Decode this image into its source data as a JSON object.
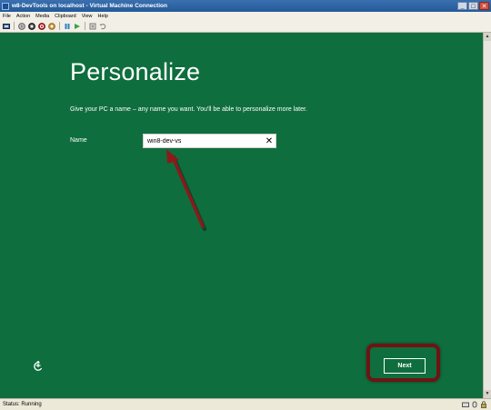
{
  "window": {
    "title": "w8-DevTools on localhost - Virtual Machine Connection",
    "minimize_glyph": "_",
    "maximize_glyph": "□",
    "close_glyph": "✕"
  },
  "menu": {
    "items": [
      "File",
      "Action",
      "Media",
      "Clipboard",
      "View",
      "Help"
    ]
  },
  "toolbar": {
    "icons": [
      "ctrl-alt-del-icon",
      "start-icon",
      "turn-off-icon",
      "shut-down-icon",
      "save-icon",
      "pause-icon",
      "reset-icon",
      "snapshot-icon",
      "revert-icon"
    ]
  },
  "setup": {
    "title": "Personalize",
    "instructions": "Give your PC a name – any name you want. You'll be able to personalize more later.",
    "name_label": "Name",
    "name_value": "win8-dev-vs",
    "clear_glyph": "✕",
    "next_label": "Next"
  },
  "status": {
    "text": "Status: Running"
  },
  "colors": {
    "setup_background": "#0f6e3e",
    "highlight_border": "#6f1414",
    "arrow": "#8b1a1a"
  }
}
